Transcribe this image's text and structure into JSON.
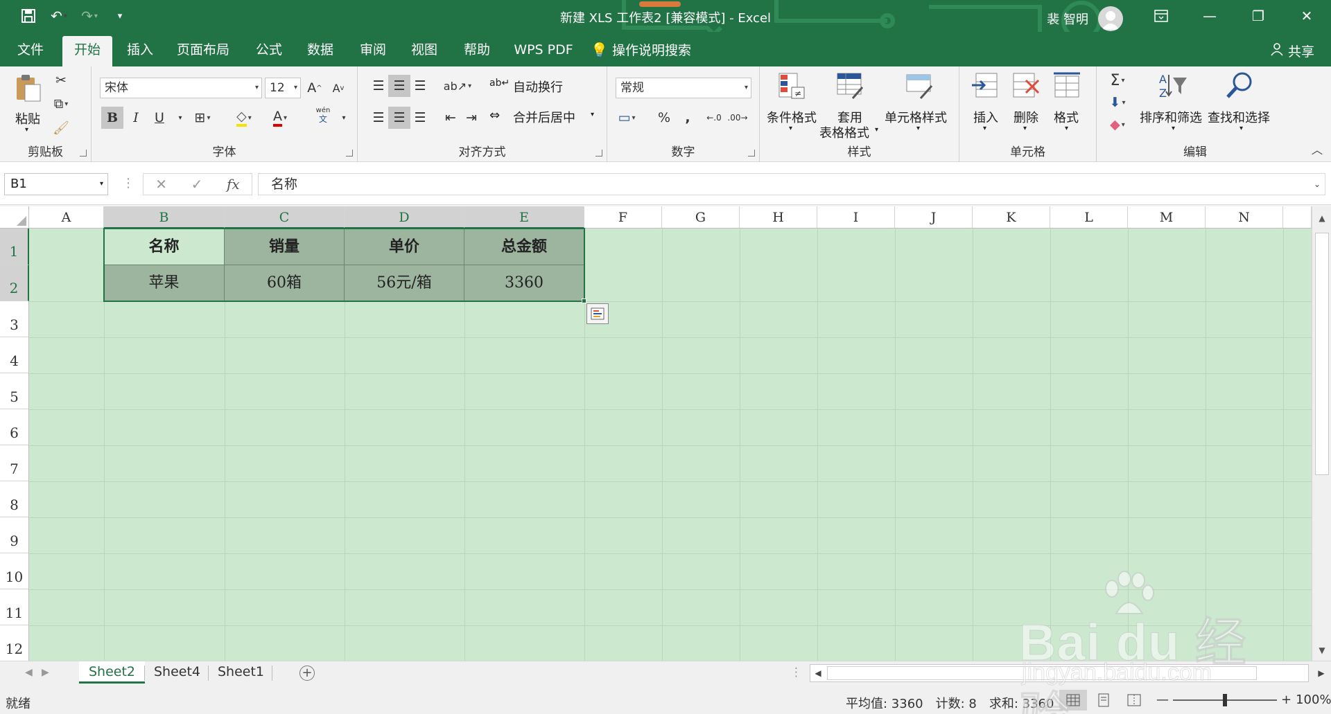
{
  "window": {
    "title": "新建 XLS 工作表2 [兼容模式] - Excel",
    "user": "裴 智明",
    "controls": [
      "ribbon-display",
      "minimize",
      "restore",
      "close"
    ]
  },
  "tabs": [
    {
      "label": "文件",
      "active": false
    },
    {
      "label": "开始",
      "active": true
    },
    {
      "label": "插入",
      "active": false
    },
    {
      "label": "页面布局",
      "active": false
    },
    {
      "label": "公式",
      "active": false
    },
    {
      "label": "数据",
      "active": false
    },
    {
      "label": "审阅",
      "active": false
    },
    {
      "label": "视图",
      "active": false
    },
    {
      "label": "帮助",
      "active": false
    },
    {
      "label": "WPS PDF",
      "active": false
    },
    {
      "label": "操作说明搜索",
      "active": false
    }
  ],
  "share": "共享",
  "ribbon": {
    "clipboard": {
      "paste": "粘贴",
      "group": "剪贴板"
    },
    "font": {
      "name": "宋体",
      "size": "12",
      "bold": "B",
      "italic": "I",
      "underline": "U",
      "phonetic": "wén",
      "group": "字体"
    },
    "alignment": {
      "wrap": "自动换行",
      "merge": "合并后居中",
      "group": "对齐方式"
    },
    "number": {
      "format": "常规",
      "percent": "%",
      "comma": ",",
      "group": "数字"
    },
    "styles": {
      "conditional": "条件格式",
      "table_1": "套用",
      "table_2": "表格格式",
      "cell_styles": "单元格样式",
      "group": "样式"
    },
    "cells": {
      "insert": "插入",
      "delete": "删除",
      "format": "格式",
      "group": "单元格"
    },
    "editing": {
      "sort": "排序和筛选",
      "find": "查找和选择",
      "group": "编辑"
    }
  },
  "formula_bar": {
    "name_box": "B1",
    "content": "名称",
    "fx": "fx"
  },
  "columns": [
    "A",
    "B",
    "C",
    "D",
    "E",
    "F",
    "G",
    "H",
    "I",
    "J",
    "K",
    "L",
    "M",
    "N"
  ],
  "rows": [
    "1",
    "2",
    "3",
    "4",
    "5",
    "6",
    "7",
    "8",
    "9",
    "10",
    "11",
    "12"
  ],
  "table": {
    "header": [
      "名称",
      "销量",
      "单价",
      "总金额"
    ],
    "row": [
      "苹果",
      "60箱",
      "56元/箱",
      "3360"
    ]
  },
  "sheets": [
    {
      "label": "Sheet2",
      "active": true
    },
    {
      "label": "Sheet4",
      "active": false
    },
    {
      "label": "Sheet1",
      "active": false
    }
  ],
  "status": {
    "ready": "就绪",
    "average": "平均值: 3360",
    "count": "计数: 8",
    "sum": "求和: 3360",
    "zoom": "100%"
  },
  "watermark": {
    "brand": "Bai du 经验",
    "url": "jingyan.baidu.com"
  },
  "colors": {
    "excel_green": "#217346",
    "sheet_bg": "#cce8cf",
    "table_fill": "#9db49f"
  }
}
